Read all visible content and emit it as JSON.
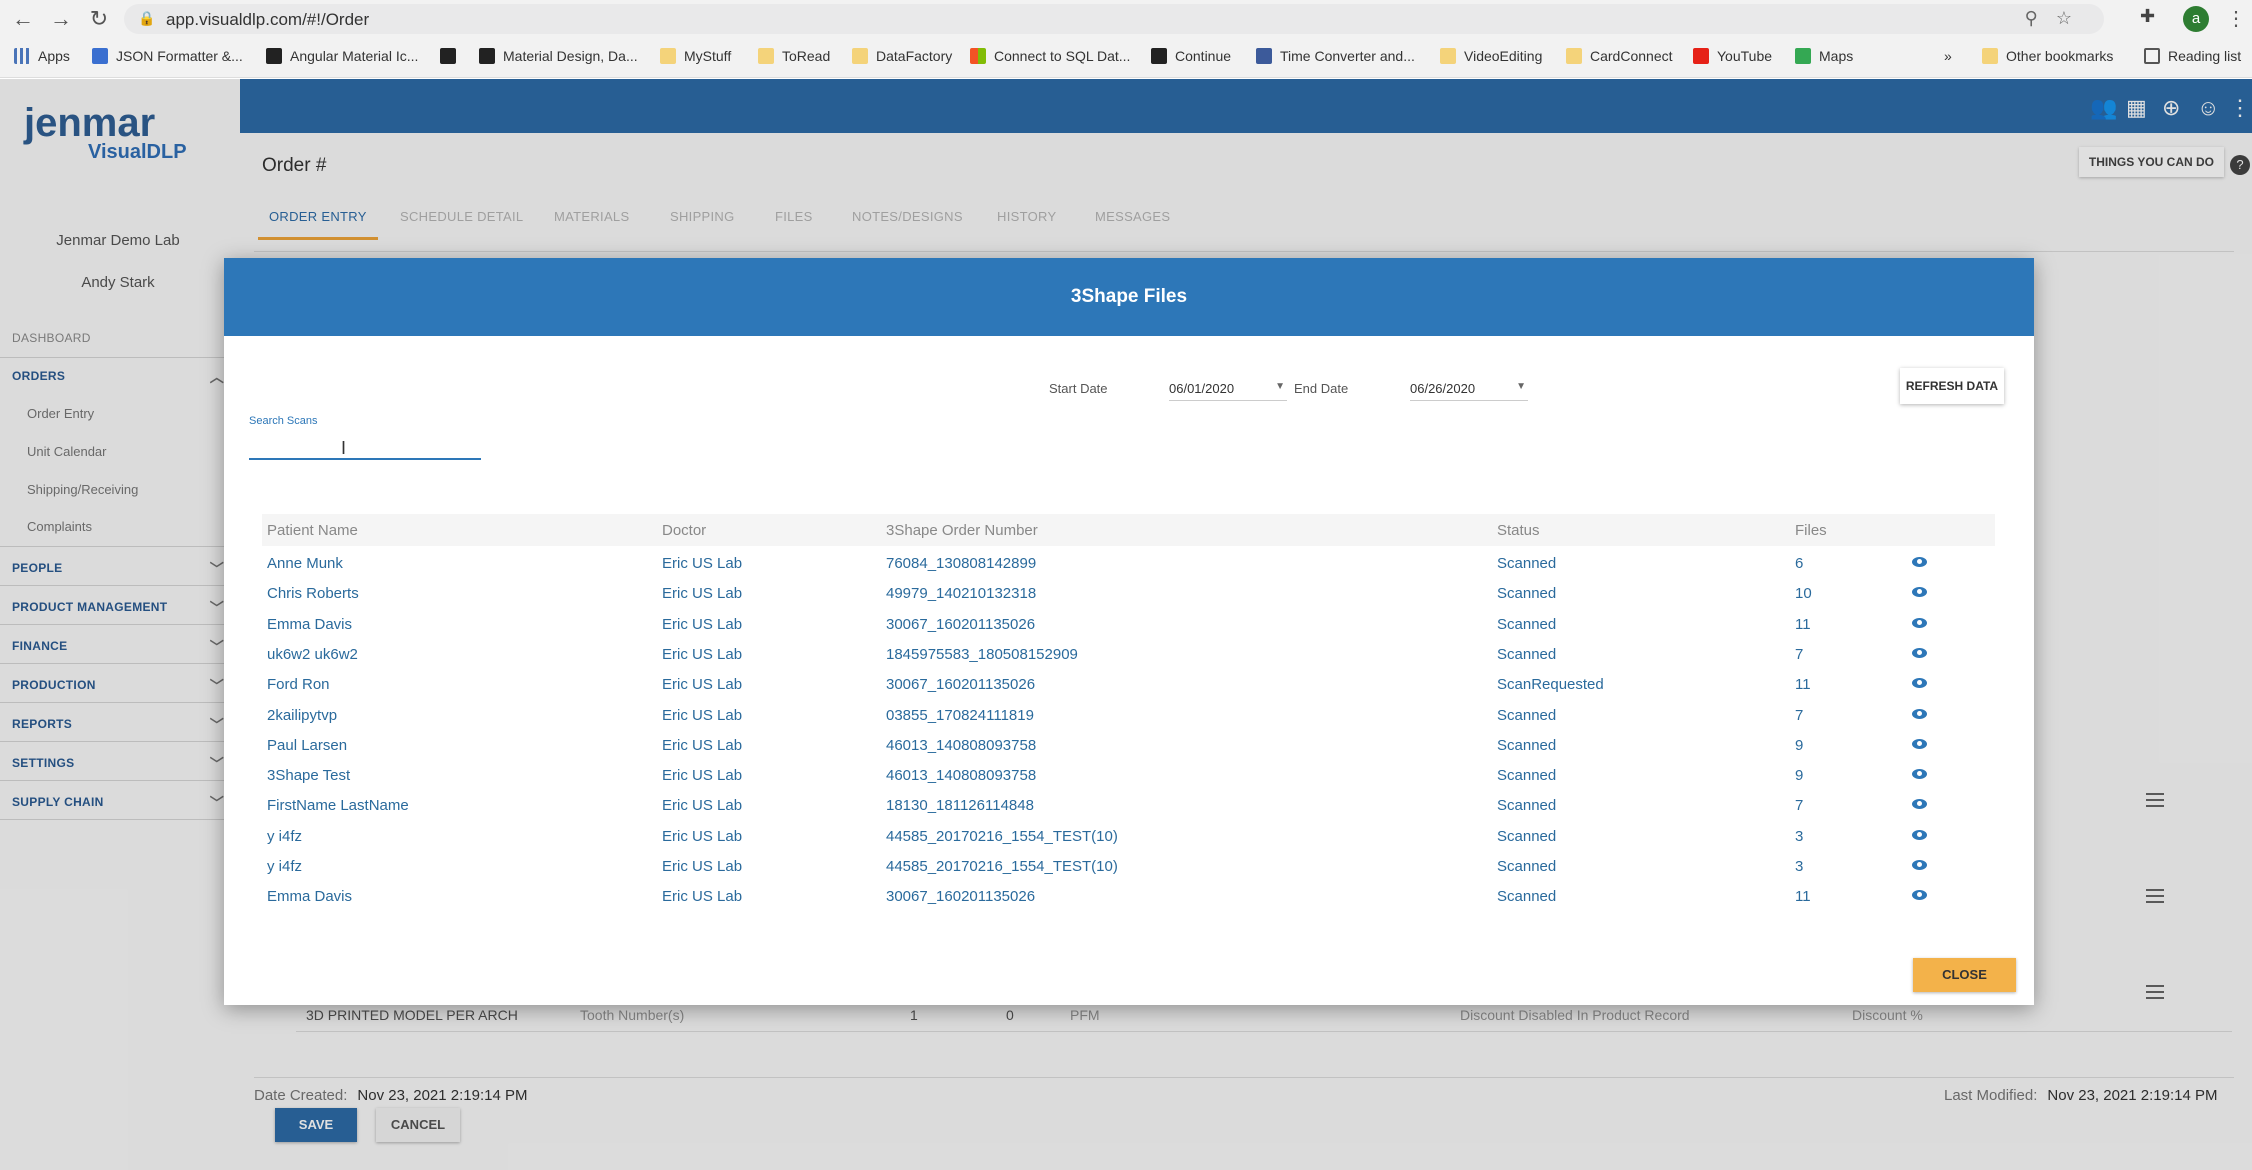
{
  "browser": {
    "url": "app.visualdlp.com/#!/Order",
    "bookmarks": [
      "Apps",
      "JSON Formatter &...",
      "Angular Material Ic...",
      "Material Design, Da...",
      "MyStuff",
      "ToRead",
      "DataFactory",
      "Connect to SQL Dat...",
      "Continue",
      "Time Converter and...",
      "VideoEditing",
      "CardConnect",
      "YouTube",
      "Maps",
      "Other bookmarks",
      "Reading list"
    ],
    "profile_initial": "a"
  },
  "sidebar": {
    "logo_main": "jenmar",
    "logo_sub": "VisualDLP",
    "lab": "Jenmar Demo Lab",
    "user": "Andy Stark",
    "dashboard": "DASHBOARD",
    "orders": "ORDERS",
    "order_items": [
      "Order Entry",
      "Unit Calendar",
      "Shipping/Receiving",
      "Complaints"
    ],
    "sections": [
      "PEOPLE",
      "PRODUCT MANAGEMENT",
      "FINANCE",
      "PRODUCTION",
      "REPORTS",
      "SETTINGS",
      "SUPPLY CHAIN"
    ]
  },
  "page": {
    "title": "Order #",
    "things_button": "THINGS YOU CAN DO",
    "tabs": [
      "ORDER ENTRY",
      "SCHEDULE DETAIL",
      "MATERIALS",
      "SHIPPING",
      "FILES",
      "NOTES/DESIGNS",
      "HISTORY",
      "MESSAGES"
    ],
    "row_product": "3D PRINTED MODEL PER ARCH",
    "row_tooth": "Tooth Number(s)",
    "row_qty": "1",
    "row_zero": "0",
    "row_type": "PFM",
    "row_discount_disabled": "Discount Disabled In Product Record",
    "row_discount": "Discount %",
    "date_created_label": "Date Created:",
    "date_created": "Nov 23, 2021 2:19:14 PM",
    "last_modified_label": "Last Modified:",
    "last_modified": "Nov 23, 2021 2:19:14 PM",
    "save": "SAVE",
    "cancel": "CANCEL"
  },
  "modal": {
    "title": "3Shape Files",
    "start_date_label": "Start Date",
    "start_date": "06/01/2020",
    "end_date_label": "End Date",
    "end_date": "06/26/2020",
    "refresh": "REFRESH DATA",
    "search_label": "Search Scans",
    "search_value": "",
    "columns": [
      "Patient Name",
      "Doctor",
      "3Shape Order Number",
      "Status",
      "Files"
    ],
    "rows": [
      {
        "patient": "Anne Munk",
        "doctor": "Eric US Lab",
        "order": "76084_130808142899",
        "status": "Scanned",
        "files": "6"
      },
      {
        "patient": "Chris Roberts",
        "doctor": "Eric US Lab",
        "order": "49979_140210132318",
        "status": "Scanned",
        "files": "10"
      },
      {
        "patient": "Emma Davis",
        "doctor": "Eric US Lab",
        "order": "30067_160201135026",
        "status": "Scanned",
        "files": "11"
      },
      {
        "patient": "uk6w2 uk6w2",
        "doctor": "Eric US Lab",
        "order": "1845975583_180508152909",
        "status": "Scanned",
        "files": "7"
      },
      {
        "patient": "Ford Ron",
        "doctor": "Eric US Lab",
        "order": "30067_160201135026",
        "status": "ScanRequested",
        "files": "11"
      },
      {
        "patient": "2kailipytvp",
        "doctor": "Eric US Lab",
        "order": "03855_170824111819",
        "status": "Scanned",
        "files": "7"
      },
      {
        "patient": "Paul Larsen",
        "doctor": "Eric US Lab",
        "order": "46013_140808093758",
        "status": "Scanned",
        "files": "9"
      },
      {
        "patient": "3Shape Test",
        "doctor": "Eric US Lab",
        "order": "46013_140808093758",
        "status": "Scanned",
        "files": "9"
      },
      {
        "patient": "FirstName LastName",
        "doctor": "Eric US Lab",
        "order": "18130_181126114848",
        "status": "Scanned",
        "files": "7"
      },
      {
        "patient": "y i4fz",
        "doctor": "Eric US Lab",
        "order": "44585_20170216_1554_TEST(10)",
        "status": "Scanned",
        "files": "3"
      },
      {
        "patient": "y i4fz",
        "doctor": "Eric US Lab",
        "order": "44585_20170216_1554_TEST(10)",
        "status": "Scanned",
        "files": "3"
      },
      {
        "patient": "Emma Davis",
        "doctor": "Eric US Lab",
        "order": "30067_160201135026",
        "status": "Scanned",
        "files": "11"
      }
    ],
    "close": "CLOSE"
  }
}
